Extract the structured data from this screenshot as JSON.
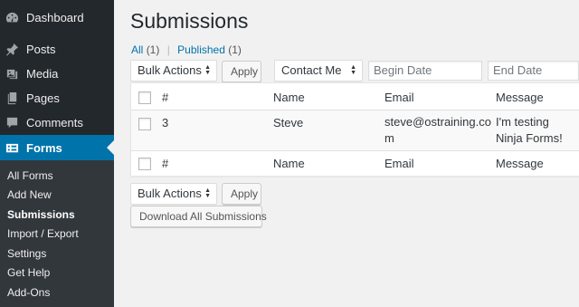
{
  "sidebar": {
    "items": [
      {
        "label": "Dashboard",
        "icon": "dashboard-icon"
      },
      {
        "label": "Posts",
        "icon": "pin-icon"
      },
      {
        "label": "Media",
        "icon": "media-icon"
      },
      {
        "label": "Pages",
        "icon": "pages-icon"
      },
      {
        "label": "Comments",
        "icon": "comment-icon"
      },
      {
        "label": "Forms",
        "icon": "forms-icon",
        "current": true
      }
    ],
    "submenu": [
      "All Forms",
      "Add New",
      "Submissions",
      "Import / Export",
      "Settings",
      "Get Help",
      "Add-Ons"
    ],
    "active_submenu": "Submissions"
  },
  "page": {
    "title": "Submissions",
    "views": {
      "all_label": "All",
      "all_count": "(1)",
      "separator": "|",
      "published_label": "Published",
      "published_count": "(1)"
    }
  },
  "filters": {
    "bulk_actions": "Bulk Actions",
    "apply": "Apply",
    "form_select": "Contact Me",
    "begin_date_placeholder": "Begin Date",
    "end_date_placeholder": "End Date"
  },
  "table": {
    "headers": {
      "id": "#",
      "name": "Name",
      "email": "Email",
      "message": "Message"
    },
    "rows": [
      {
        "id": "3",
        "name": "Steve",
        "email": "steve@ostraining.com",
        "message": "I'm testing Ninja Forms!"
      }
    ]
  },
  "bottom": {
    "bulk_actions": "Bulk Actions",
    "apply": "Apply",
    "download": "Download All Submissions"
  },
  "colors": {
    "sidebar_bg": "#23282d",
    "submenu_bg": "#32373c",
    "accent": "#0073aa",
    "page_bg": "#f1f1f1"
  }
}
